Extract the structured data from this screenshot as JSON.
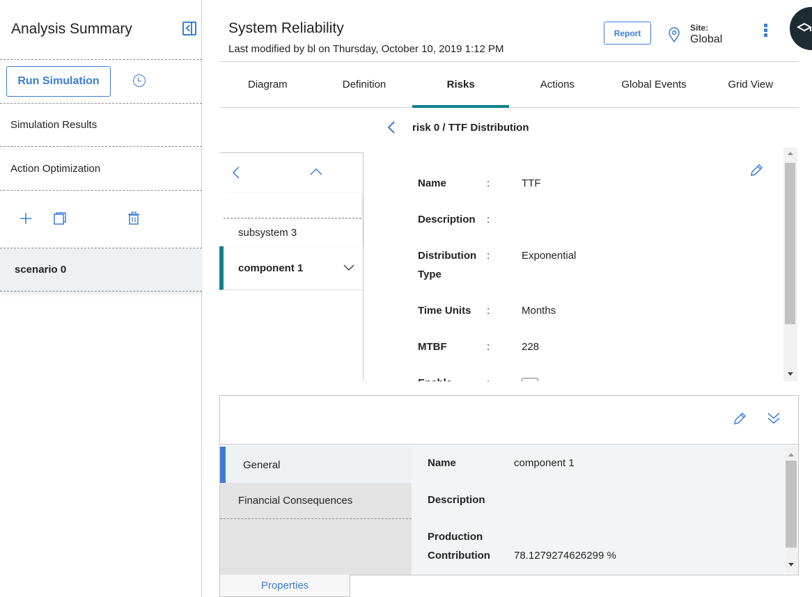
{
  "sidebar": {
    "title": "Analysis Summary",
    "run_button": "Run Simulation",
    "items": [
      {
        "label": "Simulation Results"
      },
      {
        "label": "Action Optimization"
      }
    ],
    "scenario": "scenario 0"
  },
  "header": {
    "title": "System Reliability",
    "subtitle": "Last modified by bl on Thursday, October 10, 2019 1:12 PM",
    "report_button": "Report",
    "site_label": "Site:",
    "site_value": "Global"
  },
  "tabs": [
    {
      "label": "Diagram",
      "active": false
    },
    {
      "label": "Definition",
      "active": false
    },
    {
      "label": "Risks",
      "active": true
    },
    {
      "label": "Actions",
      "active": false
    },
    {
      "label": "Global Events",
      "active": false
    },
    {
      "label": "Grid View",
      "active": false
    }
  ],
  "breadcrumb": "risk 0 / TTF Distribution",
  "tree": {
    "items": [
      {
        "label": "subsystem 3"
      },
      {
        "label": "component 1"
      }
    ]
  },
  "risk_form": {
    "fields": [
      {
        "label": "Name",
        "value": "TTF"
      },
      {
        "label": "Description",
        "value": ""
      },
      {
        "label_line1": "Distribution",
        "label_line2": "Type",
        "value": "Exponential"
      },
      {
        "label": "Time Units",
        "value": "Months"
      },
      {
        "label": "MTBF",
        "value": "228"
      },
      {
        "label": "Enable",
        "value": ""
      }
    ],
    "separator": ":"
  },
  "bottom_panel": {
    "nav": [
      {
        "label": "General"
      },
      {
        "label": "Financial Consequences"
      }
    ],
    "fields": [
      {
        "label": "Name",
        "value": "component 1"
      },
      {
        "label": "Description",
        "value": ""
      },
      {
        "label_line1": "Production",
        "label_line2": "Contribution",
        "value": "78.1279274626299 %"
      }
    ],
    "tab": "Properties"
  },
  "colors": {
    "accent_blue": "#3b7dd8",
    "teal": "#12808b"
  }
}
